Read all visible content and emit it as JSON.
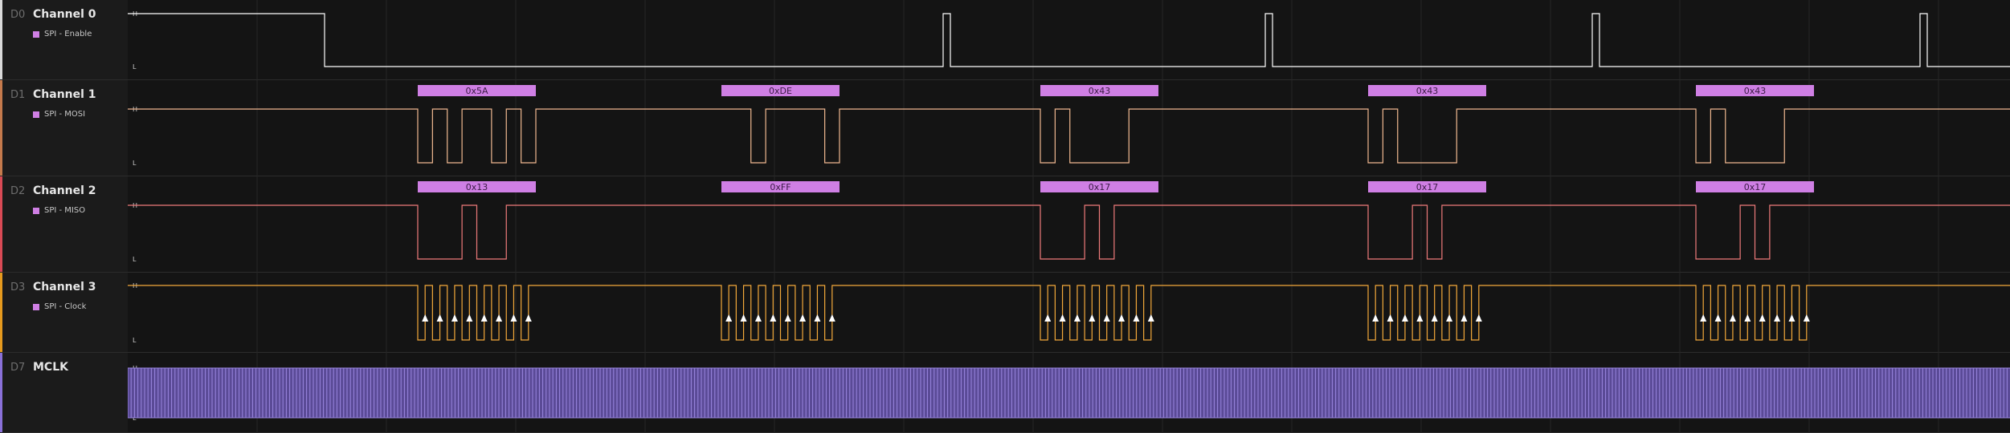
{
  "channels": [
    {
      "code": "D0",
      "name": "Channel 0",
      "analyzer": "SPI - Enable",
      "color": "#ffffff",
      "stripe": "#d9d9d9"
    },
    {
      "code": "D1",
      "name": "Channel 1",
      "analyzer": "SPI - MOSI",
      "color": "#f0b890",
      "stripe": "#c57a4c"
    },
    {
      "code": "D2",
      "name": "Channel 2",
      "analyzer": "SPI - MISO",
      "color": "#ef7b7b",
      "stripe": "#d94a55"
    },
    {
      "code": "D3",
      "name": "Channel 3",
      "analyzer": "SPI - Clock",
      "color": "#f4a93a",
      "stripe": "#e69a1e"
    },
    {
      "code": "D7",
      "name": "MCLK",
      "analyzer": "",
      "color": "#9a86e0",
      "stripe": "#8a70d8"
    }
  ],
  "level_high": "H",
  "level_low": "L",
  "mosi_bytes": [
    "0x5A",
    "0xDE",
    "0x43",
    "0x43",
    "0x43"
  ],
  "miso_bytes": [
    "0x13",
    "0xFF",
    "0x17",
    "0x17",
    "0x17"
  ],
  "colors": {
    "decode_bg": "#cf7fe4",
    "decode_text": "#3a1a44",
    "grid": "#262626",
    "arrow": "#ffffff",
    "mclk_fill": "#5a4a96"
  }
}
